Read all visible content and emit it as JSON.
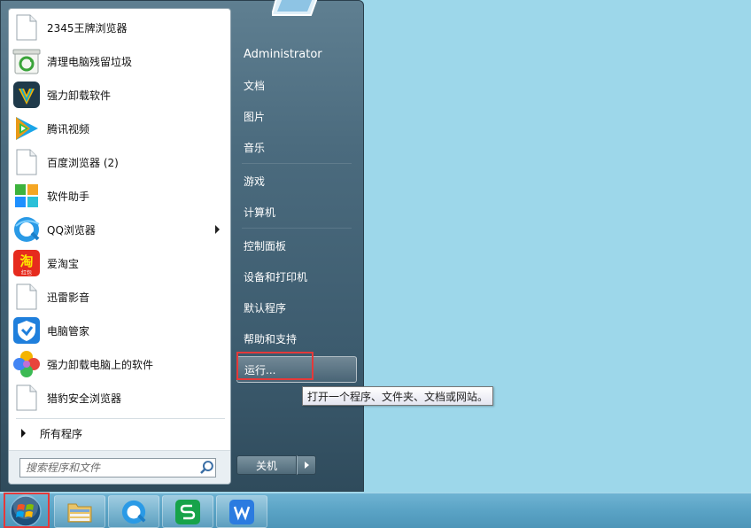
{
  "programs": [
    {
      "label": "2345王牌浏览器",
      "icon": "blank-file-icon"
    },
    {
      "label": "清理电脑残留垃圾",
      "icon": "recycle-icon"
    },
    {
      "label": "强力卸载软件",
      "icon": "uninstaller-icon"
    },
    {
      "label": "腾讯视频",
      "icon": "tencent-video-icon"
    },
    {
      "label": "百度浏览器 (2)",
      "icon": "blank-file-icon"
    },
    {
      "label": "软件助手",
      "icon": "software-helper-icon"
    },
    {
      "label": "QQ浏览器",
      "icon": "qq-browser-icon"
    },
    {
      "label": "爱淘宝",
      "icon": "taobao-icon"
    },
    {
      "label": "迅雷影音",
      "icon": "blank-file-icon"
    },
    {
      "label": "电脑管家",
      "icon": "pc-manager-icon"
    },
    {
      "label": "强力卸载电脑上的软件",
      "icon": "flower-icon"
    },
    {
      "label": "猎豹安全浏览器",
      "icon": "blank-file-icon"
    }
  ],
  "taobao_icon_caption": "红包",
  "all_programs_label": "所有程序",
  "search": {
    "placeholder": "搜索程序和文件"
  },
  "right_menu": {
    "user": "Administrator",
    "documents": "文档",
    "pictures": "图片",
    "music": "音乐",
    "games": "游戏",
    "computer": "计算机",
    "control_panel": "控制面板",
    "devices_printers": "设备和打印机",
    "default_programs": "默认程序",
    "help_support": "帮助和支持",
    "run": "运行..."
  },
  "shutdown_label": "关机",
  "tooltip": "打开一个程序、文件夹、文档或网站。",
  "taskbar": {
    "items": [
      "start-orb",
      "file-explorer-icon",
      "qq-browser-icon",
      "wps-spreadsheet-icon",
      "wps-writer-icon"
    ]
  },
  "colors": {
    "highlight_red": "#e53939",
    "desktop": "#9dd7ea"
  }
}
